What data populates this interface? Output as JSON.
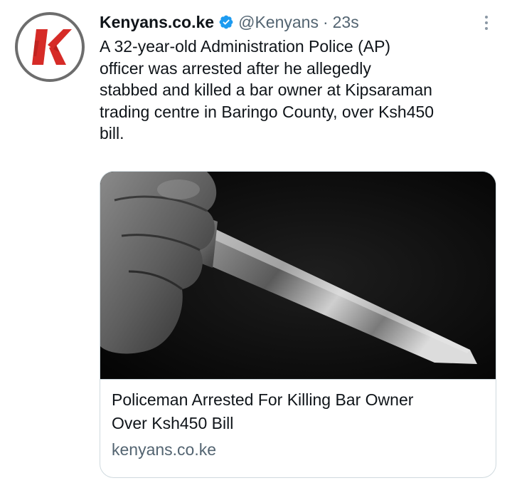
{
  "tweet": {
    "display_name": "Kenyans.co.ke",
    "handle": "@Kenyans",
    "separator": "·",
    "time": "23s",
    "text": "A 32-year-old Administration Police (AP)\nofficer was arrested after he allegedly\nstabbed and killed a bar owner at Kipsaraman\ntrading centre in Baringo County, over Ksh450\nbill.",
    "avatar_icon": "kenyans-k-logo",
    "verified_icon": "verified-badge-icon",
    "more_icon": "more-vertical-icon"
  },
  "card": {
    "title": "Policeman Arrested For Killing Bar Owner\nOver Ksh450 Bill",
    "domain": "kenyans.co.ke",
    "image_subject": "hand-holding-knife"
  },
  "colors": {
    "brand_red": "#d62b27",
    "verified_blue": "#1d9bf0",
    "secondary_text": "#536471",
    "border": "#cfd9de"
  }
}
